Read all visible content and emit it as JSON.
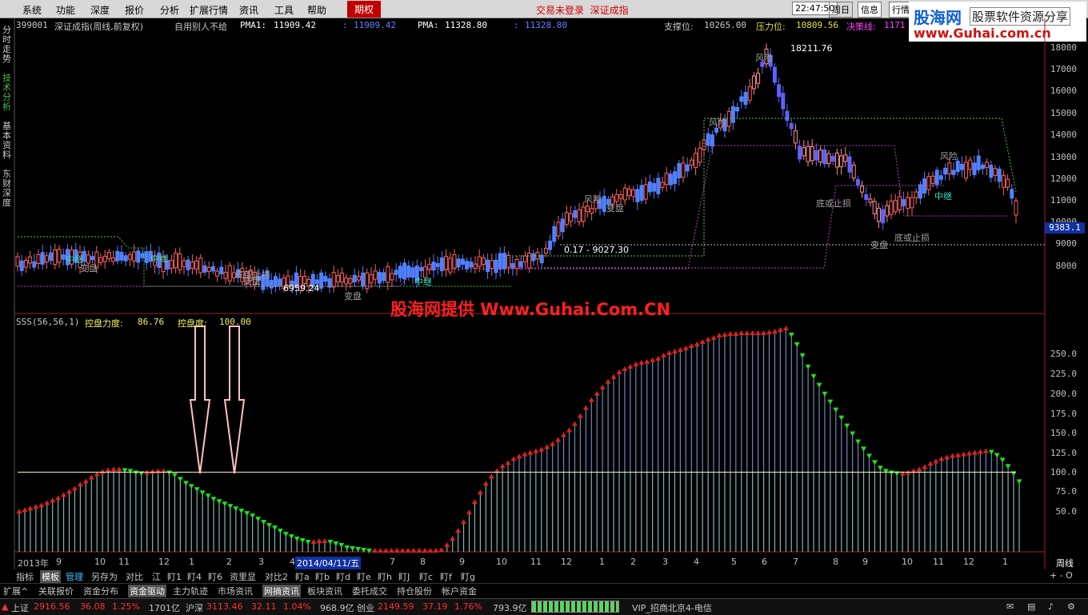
{
  "menu": {
    "items": [
      "系统",
      "功能",
      "深度",
      "报价",
      "分析",
      "扩展行情",
      "资讯",
      "工具",
      "帮助"
    ],
    "highlight": "期权",
    "status_text": "交易未登录  深证成指",
    "time": "22:47:50",
    "weekday": "周日",
    "info_button": "信息",
    "quote_button": "行情"
  },
  "brand": {
    "line1": "股海网",
    "line2": "股票软件资源分享",
    "url": "www.Guhai.com.cn"
  },
  "side_tabs": [
    "分时走势",
    "技术分析",
    "基本资料",
    "东财深度"
  ],
  "header": {
    "code": "399001",
    "name": "深证成指(周线,前复权)",
    "formula": "自用别人不给",
    "pma1_label": "PMA1:",
    "pma1_value": "11909.42",
    "sep1": ":",
    "pma1_value2": "11909.42",
    "pma_label": "PMA:",
    "pma_value": "11328.80",
    "sep2": ":",
    "pma_value2": "11328.80",
    "support_label": "支撑位:",
    "support_value": "10265.00",
    "pressure_label": "压力位:",
    "pressure_value": "10809.56",
    "decision_label": "决策线:",
    "decision_value": "1171"
  },
  "price_axis": {
    "ticks": [
      "18000",
      "17000",
      "16000",
      "15000",
      "14000",
      "13000",
      "12000",
      "11000",
      "10000",
      "9000",
      "8000"
    ],
    "current": "9383.1"
  },
  "annotations": {
    "high": "18211.76",
    "low": "6959.24",
    "range_text": "0.17 - 9027.30",
    "pan1": "变盘",
    "pan2": "变盘",
    "pan3": "变盘",
    "pan4": "变盘",
    "pan5": "变盘",
    "zhongji1": "中继",
    "zhongji2": "中继",
    "zhongji3": "中继",
    "zhongji4": "中继",
    "risk1": "风险",
    "risk2": "风险",
    "risk3": "风险",
    "risk4": "风险",
    "stop1": "底或止损",
    "stop2": "底或止损",
    "stop3": "底或止损"
  },
  "watermark": "股海网提供 Www.Guhai.Com.CN",
  "indicator": {
    "name": "SSS(56,56,1)",
    "force_label": "控盘力度:",
    "force_value": "86.76",
    "degree_label": "控盘度:",
    "degree_value": "100.00",
    "axis": [
      "250.0",
      "225.0",
      "200.0",
      "175.0",
      "150.0",
      "125.0",
      "100.0",
      "75.0",
      "50.0"
    ]
  },
  "chart_data": {
    "type": "bar",
    "title": "SSS(56,56,1)",
    "ylim": [
      0,
      275
    ],
    "reference_line": 100,
    "values": [
      50,
      52,
      54,
      56,
      58,
      61,
      64,
      67,
      71,
      75,
      79,
      84,
      88,
      93,
      97,
      100,
      102,
      103,
      103,
      102,
      101,
      99,
      98,
      99,
      100,
      101,
      101,
      99,
      96,
      91,
      86,
      82,
      78,
      74,
      70,
      66,
      63,
      60,
      57,
      54,
      51,
      48,
      45,
      41,
      37,
      33,
      30,
      26,
      22,
      19,
      16,
      14,
      12,
      12,
      13,
      13,
      12,
      10,
      8,
      5,
      4,
      3,
      2,
      1,
      1,
      1,
      1,
      1,
      1,
      1,
      1,
      1,
      1,
      1,
      1,
      1,
      2,
      8,
      16,
      26,
      37,
      49,
      62,
      74,
      85,
      94,
      101,
      107,
      111,
      116,
      119,
      122,
      124,
      126,
      128,
      131,
      135,
      140,
      146,
      152,
      160,
      170,
      180,
      190,
      198,
      206,
      213,
      219,
      225,
      229,
      232,
      235,
      237,
      238,
      240,
      242,
      246,
      249,
      251,
      253,
      255,
      258,
      260,
      263,
      266,
      268,
      271,
      272,
      273,
      273,
      274,
      274,
      274,
      274,
      274,
      275,
      276,
      278,
      280,
      272,
      260,
      246,
      232,
      220,
      209,
      198,
      188,
      178,
      168,
      158,
      148,
      138,
      129,
      120,
      112,
      105,
      101,
      99,
      98,
      98,
      99,
      101,
      103,
      106,
      110,
      113,
      116,
      118,
      120,
      121,
      122,
      123,
      124,
      125,
      126,
      125,
      121,
      115,
      107,
      98,
      88
    ],
    "x_ticks": [
      "2013年",
      "9",
      "10",
      "11",
      "12",
      "1",
      "2",
      "3",
      "4",
      "2014/04/11/五",
      "7",
      "8",
      "9",
      "10",
      "11",
      "12",
      "1",
      "2",
      "3",
      "4",
      "5",
      "6",
      "7",
      "8",
      "9",
      "10",
      "11",
      "12",
      "1"
    ],
    "period_label": "周线"
  },
  "tabs_row1": [
    "指标",
    "模板",
    "管理",
    "另存为",
    "对比",
    "江",
    "盯1",
    "盯4",
    "盯6",
    "资里显",
    "对比2",
    "盯a",
    "盯b",
    "盯d",
    "盯e",
    "盯h",
    "盯J",
    "盯c",
    "盯f",
    "盯g"
  ],
  "tabs_row1_right": "+ - O",
  "tabs_row2": [
    "扩展^",
    "关联报价",
    "资金分布",
    "资金驱动",
    "主力轨迹",
    "市场资讯",
    "网摘资讯",
    "板块资讯",
    "委托成交",
    "持仓股份",
    "帐户资金"
  ],
  "statusbar": {
    "sh_label": "上证",
    "sh_value": "2916.56",
    "sh_change": "36.08",
    "sh_pct": "1.25%",
    "sh_amount": "1701亿",
    "sz_label": "沪深",
    "sz_value": "3113.46",
    "sz_change": "32.11",
    "sz_pct": "1.04%",
    "sz_amount": "968.9亿",
    "cy_label": "创业",
    "cy_value": "2149.59",
    "cy_change": "37.19",
    "cy_pct": "1.76%",
    "cy_amount": "793.9亿",
    "server": "VIP_招商北京4-电信"
  },
  "colors": {
    "up": "#ff3232",
    "down": "#00e0e0",
    "bar": "#6a8ab8",
    "volume_base": "#7fb5b5"
  }
}
